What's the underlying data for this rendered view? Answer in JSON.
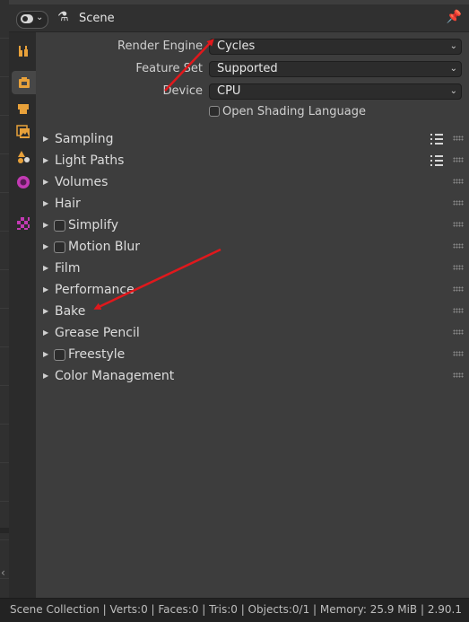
{
  "header": {
    "editor_type_icon": "properties-editor-toggle-icon",
    "scene_icon": "scene-icon",
    "scene_title": "Scene",
    "pin_icon": "pin-icon"
  },
  "tabs": [
    {
      "name": "tool",
      "icon": "wrench-screwdriver-icon",
      "color": "#e8a13a"
    },
    {
      "name": "render",
      "icon": "camera-back-icon",
      "color": "#e8a13a",
      "active": true
    },
    {
      "name": "output",
      "icon": "printer-icon",
      "color": "#e8a13a"
    },
    {
      "name": "view-layer",
      "icon": "image-stack-icon",
      "color": "#e8a13a"
    },
    {
      "name": "scene",
      "icon": "cone-sphere-icon",
      "color": "#e8a13a"
    },
    {
      "name": "world",
      "icon": "globe-icon",
      "color": "#c23ab3"
    },
    {
      "name": "texture",
      "icon": "checker-icon",
      "color": "#c23ab3"
    }
  ],
  "render": {
    "render_engine_label": "Render Engine",
    "render_engine_value": "Cycles",
    "feature_set_label": "Feature Set",
    "feature_set_value": "Supported",
    "device_label": "Device",
    "device_value": "CPU",
    "osl_label": "Open Shading Language",
    "osl_checked": false
  },
  "panels": [
    {
      "label": "Sampling",
      "checkbox": false,
      "list_icon": true
    },
    {
      "label": "Light Paths",
      "checkbox": false,
      "list_icon": true
    },
    {
      "label": "Volumes",
      "checkbox": false,
      "list_icon": false
    },
    {
      "label": "Hair",
      "checkbox": false,
      "list_icon": false
    },
    {
      "label": "Simplify",
      "checkbox": true,
      "list_icon": false
    },
    {
      "label": "Motion Blur",
      "checkbox": true,
      "list_icon": false
    },
    {
      "label": "Film",
      "checkbox": false,
      "list_icon": false
    },
    {
      "label": "Performance",
      "checkbox": false,
      "list_icon": false
    },
    {
      "label": "Bake",
      "checkbox": false,
      "list_icon": false
    },
    {
      "label": "Grease Pencil",
      "checkbox": false,
      "list_icon": false
    },
    {
      "label": "Freestyle",
      "checkbox": true,
      "list_icon": false
    },
    {
      "label": "Color Management",
      "checkbox": false,
      "list_icon": false
    }
  ],
  "status_bar": {
    "text": "Scene Collection | Verts:0 | Faces:0 | Tris:0 | Objects:0/1 | Memory: 25.9 MiB | 2.90.1"
  },
  "colors": {
    "annotation_arrow": "#e0181c",
    "accent_orange": "#e8a13a",
    "accent_magenta": "#c23ab3"
  }
}
